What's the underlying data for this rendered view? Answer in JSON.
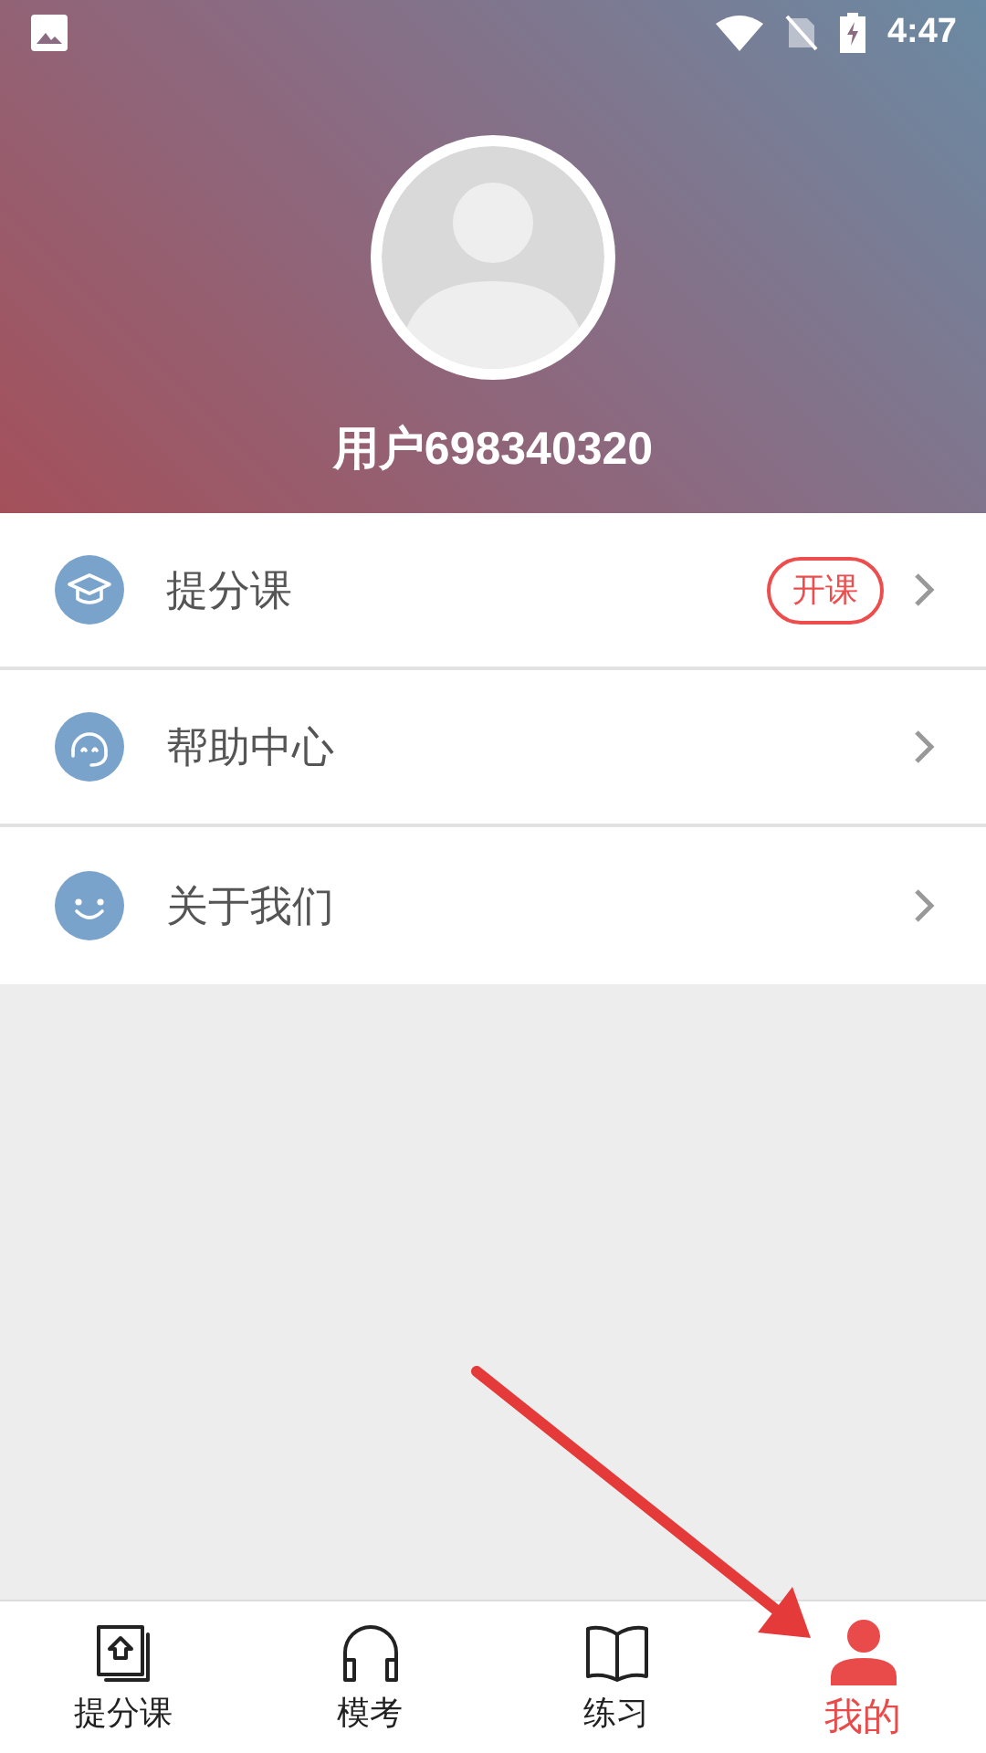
{
  "status_bar": {
    "time": "4:47"
  },
  "profile": {
    "username": "用户698340320"
  },
  "menu": [
    {
      "kind": "graduation",
      "label": "提分课",
      "badge": "开课"
    },
    {
      "kind": "headset",
      "label": "帮助中心"
    },
    {
      "kind": "smile",
      "label": "关于我们"
    }
  ],
  "tabs": [
    {
      "kind": "book-up",
      "label": "提分课",
      "selected": false
    },
    {
      "kind": "headphones",
      "label": "模考",
      "selected": false
    },
    {
      "kind": "book-open",
      "label": "练习",
      "selected": false
    },
    {
      "kind": "person",
      "label": "我的",
      "selected": true
    }
  ]
}
